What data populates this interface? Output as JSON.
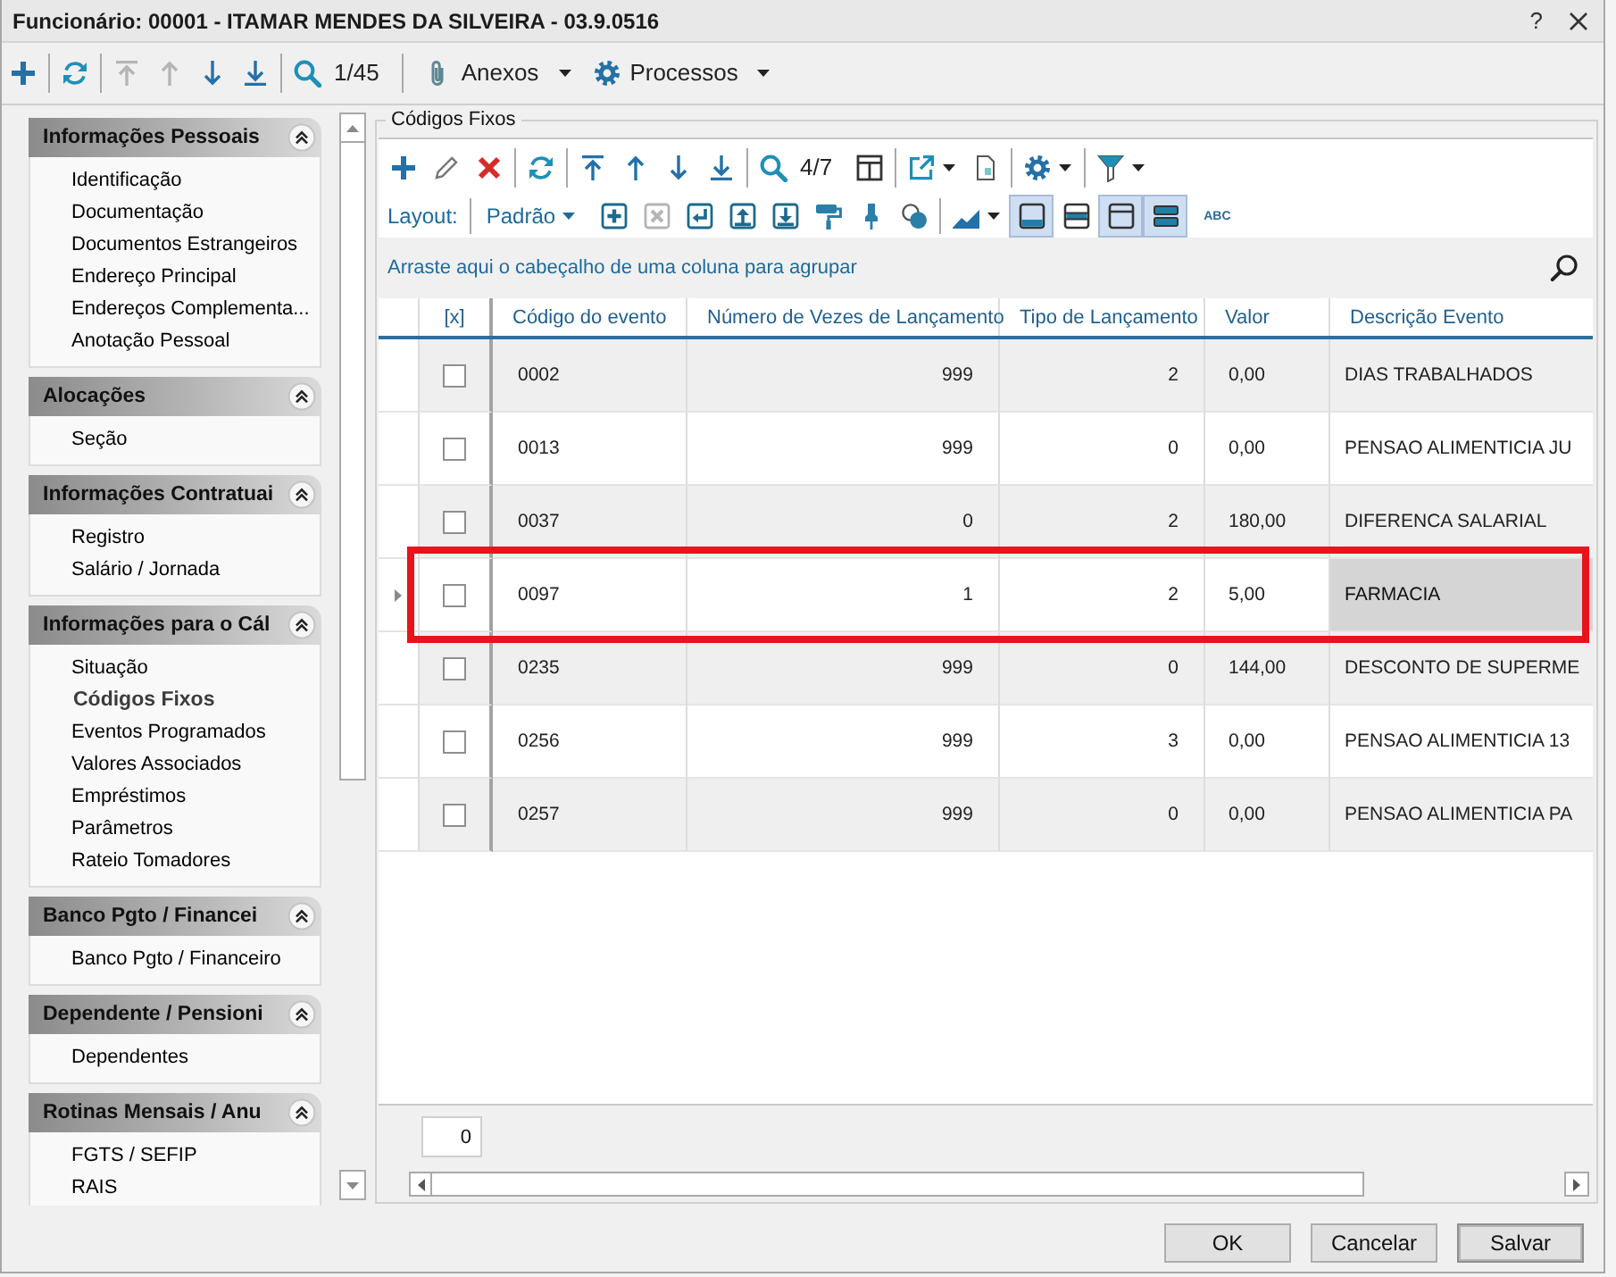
{
  "window": {
    "title": "Funcionário: 00001 - ITAMAR MENDES DA SILVEIRA - 03.9.0516",
    "help": "?"
  },
  "toolbar": {
    "first_record": {
      "disabled": true
    },
    "previous_record": {
      "disabled": true
    },
    "next_record": {
      "disabled": false
    },
    "last_record": {
      "disabled": false
    },
    "record_position": "1/45",
    "attachments_menu": "Anexos",
    "processes_menu": "Processos"
  },
  "sidebar": {
    "groups": [
      {
        "title": "Informações Pessoais",
        "expanded": true,
        "items": [
          {
            "label": "Identificação",
            "selected": false
          },
          {
            "label": "Documentação",
            "selected": false
          },
          {
            "label": "Documentos Estrangeiros",
            "selected": false
          },
          {
            "label": "Endereço Principal",
            "selected": false
          },
          {
            "label": "Endereços Complementa...",
            "selected": false
          },
          {
            "label": "Anotação Pessoal",
            "selected": false
          }
        ]
      },
      {
        "title": "Alocações",
        "expanded": true,
        "items": [
          {
            "label": "Seção",
            "selected": false
          }
        ]
      },
      {
        "title": "Informações Contratuai",
        "expanded": true,
        "items": [
          {
            "label": "Registro",
            "selected": false
          },
          {
            "label": "Salário / Jornada",
            "selected": false
          }
        ]
      },
      {
        "title": "Informações para o Cál",
        "expanded": true,
        "items": [
          {
            "label": "Situação",
            "selected": false
          },
          {
            "label": "Códigos Fixos",
            "selected": true
          },
          {
            "label": "Eventos Programados",
            "selected": false
          },
          {
            "label": "Valores Associados",
            "selected": false
          },
          {
            "label": "Empréstimos",
            "selected": false
          },
          {
            "label": "Parâmetros",
            "selected": false
          },
          {
            "label": "Rateio Tomadores",
            "selected": false
          }
        ]
      },
      {
        "title": "Banco Pgto / Financei",
        "expanded": true,
        "items": [
          {
            "label": "Banco Pgto / Financeiro",
            "selected": false
          }
        ]
      },
      {
        "title": "Dependente / Pensioni",
        "expanded": true,
        "items": [
          {
            "label": "Dependentes",
            "selected": false
          }
        ]
      },
      {
        "title": "Rotinas Mensais / Anu",
        "expanded": true,
        "items": [
          {
            "label": "FGTS / SEFIP",
            "selected": false
          },
          {
            "label": "RAIS",
            "selected": false
          }
        ]
      }
    ]
  },
  "panel": {
    "title": "Códigos Fixos",
    "toolbar": {
      "record_position": "4/7",
      "layout_label": "Layout:",
      "layout_menu": "Padrão",
      "layout_tools": [
        {
          "disabled": false
        },
        {
          "disabled": true
        },
        {
          "disabled": false
        },
        {
          "disabled": false
        },
        {
          "disabled": false
        },
        {
          "disabled": false
        },
        {
          "disabled": false
        },
        {
          "disabled": false
        }
      ],
      "view_toggles": [
        {
          "on": true
        },
        {
          "on": false
        },
        {
          "on": true
        },
        {
          "on": true
        }
      ],
      "text_tool": "ABC"
    },
    "group_by_hint": "Arraste aqui o cabeçalho de uma coluna para agrupar",
    "table": {
      "checkbox_column": "[x]",
      "columns": [
        "Código do evento",
        "Número de Vezes de Lançamento",
        "Tipo de Lançamento",
        "Valor",
        "Descrição Evento"
      ],
      "rows": [
        {
          "checked": false,
          "selected": false,
          "outlined": false,
          "cells": [
            "0002",
            "999",
            "2",
            "0,00",
            "DIAS TRABALHADOS"
          ]
        },
        {
          "checked": false,
          "selected": false,
          "outlined": false,
          "cells": [
            "0013",
            "999",
            "0",
            "0,00",
            "PENSAO ALIMENTICIA JU"
          ]
        },
        {
          "checked": false,
          "selected": false,
          "outlined": false,
          "cells": [
            "0037",
            "0",
            "2",
            "180,00",
            "DIFERENCA SALARIAL"
          ]
        },
        {
          "checked": false,
          "selected": true,
          "outlined": true,
          "cells": [
            "0097",
            "1",
            "2",
            "5,00",
            "FARMACIA"
          ]
        },
        {
          "checked": false,
          "selected": false,
          "outlined": false,
          "cells": [
            "0235",
            "999",
            "0",
            "144,00",
            "DESCONTO DE SUPERME"
          ]
        },
        {
          "checked": false,
          "selected": false,
          "outlined": false,
          "cells": [
            "0256",
            "999",
            "3",
            "0,00",
            "PENSAO ALIMENTICIA 13"
          ]
        },
        {
          "checked": false,
          "selected": false,
          "outlined": false,
          "cells": [
            "0257",
            "999",
            "0",
            "0,00",
            "PENSAO ALIMENTICIA PA"
          ]
        }
      ]
    },
    "row_count": "0"
  },
  "buttons": [
    {
      "label": "OK",
      "default": false
    },
    {
      "label": "Cancelar",
      "default": false
    },
    {
      "label": "Salvar",
      "default": true
    }
  ]
}
